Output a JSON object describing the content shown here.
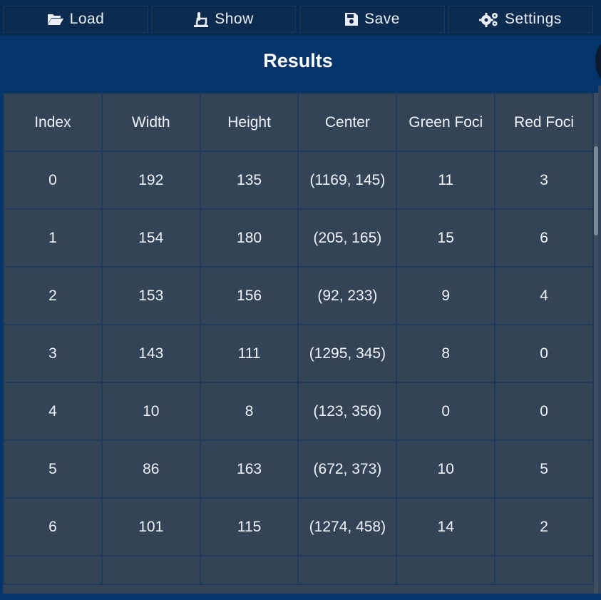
{
  "toolbar": {
    "buttons": [
      {
        "label": "Load",
        "icon": "folder-open-icon"
      },
      {
        "label": "Show",
        "icon": "show-hand-icon"
      },
      {
        "label": "Save",
        "icon": "floppy-disk-icon"
      },
      {
        "label": "Settings",
        "icon": "gears-icon"
      }
    ]
  },
  "results": {
    "title": "Results",
    "columns": [
      "Index",
      "Width",
      "Height",
      "Center",
      "Green Foci",
      "Red Foci"
    ],
    "rows": [
      [
        "0",
        "192",
        "135",
        "(1169, 145)",
        "11",
        "3"
      ],
      [
        "1",
        "154",
        "180",
        "(205, 165)",
        "15",
        "6"
      ],
      [
        "2",
        "153",
        "156",
        "(92, 233)",
        "9",
        "4"
      ],
      [
        "3",
        "143",
        "111",
        "(1295, 345)",
        "8",
        "0"
      ],
      [
        "4",
        "10",
        "8",
        "(123, 356)",
        "0",
        "0"
      ],
      [
        "5",
        "86",
        "163",
        "(672, 373)",
        "10",
        "5"
      ],
      [
        "6",
        "101",
        "115",
        "(1274, 458)",
        "14",
        "2"
      ]
    ]
  },
  "colors": {
    "background": "#04346a",
    "cell": "#344457",
    "grid": "#203a59",
    "button": "#0d2a4f"
  }
}
